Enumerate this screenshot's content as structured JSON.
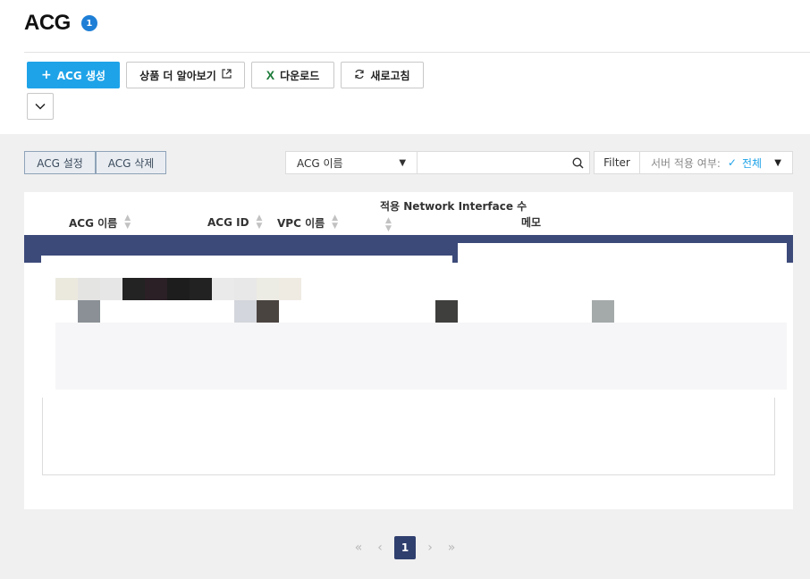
{
  "header": {
    "title": "ACG",
    "count": "1"
  },
  "toolbar": {
    "create_label": "ACG 생성",
    "learn_more_label": "상품 더 알아보기",
    "download_label": "다운로드",
    "refresh_label": "새로고침"
  },
  "actions": {
    "settings_label": "ACG 설정",
    "delete_label": "ACG 삭제"
  },
  "search": {
    "field_label": "ACG 이름",
    "value": ""
  },
  "filter": {
    "button_label": "Filter",
    "apply_label": "서버 적용 여부:",
    "apply_value": "전체"
  },
  "table": {
    "columns": {
      "name": "ACG 이름",
      "id": "ACG ID",
      "vpc": "VPC 이름",
      "nic_count": "적용 Network Interface 수",
      "memo": "메모"
    }
  },
  "pagination": {
    "current": "1"
  },
  "icons": {
    "create": "plus-icon",
    "learn_more": "external-link-icon",
    "download": "excel-icon",
    "refresh": "refresh-icon",
    "collapse": "chevron-down-icon",
    "search": "search-icon",
    "check": "check-icon"
  },
  "colors": {
    "primary": "#1fa3e8",
    "badge": "#1f7fd6",
    "selected_row": "#3c4a7a",
    "page_active": "#2f3f6e"
  }
}
